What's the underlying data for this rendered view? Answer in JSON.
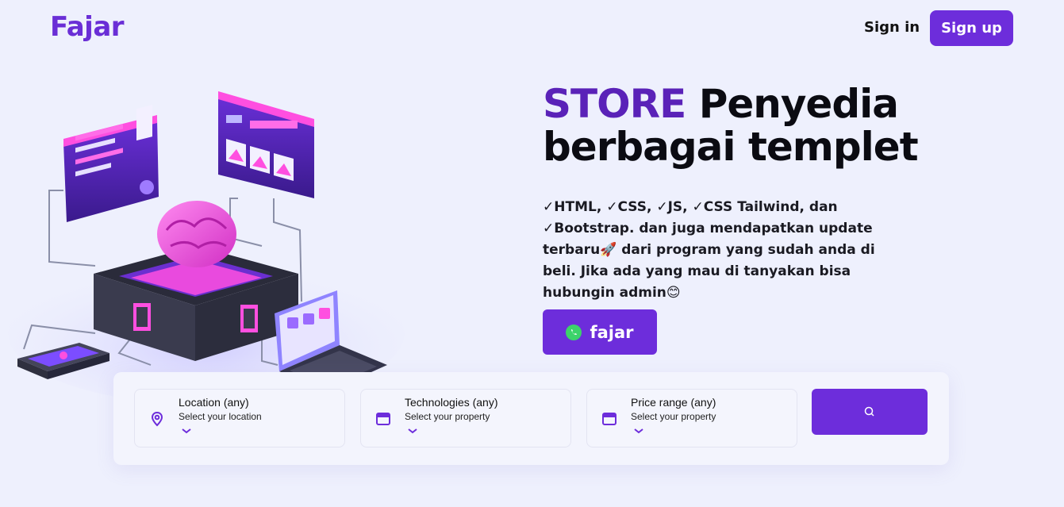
{
  "header": {
    "logo": "Fajar",
    "sign_in_label": "Sign in",
    "sign_up_label": "Sign up"
  },
  "hero": {
    "headline_accent": "STORE",
    "headline_rest": " Penyedia berbagai templet",
    "description": "✓HTML, ✓CSS, ✓JS, ✓CSS Tailwind, dan ✓Bootstrap. dan juga mendapatkan update terbaru🚀 dari program yang sudah anda di beli. Jika ada yang mau di tanyakan bisa hubungin admin😊",
    "cta_label": "fajar",
    "cta_icon": "whatsapp-icon"
  },
  "search": {
    "fields": [
      {
        "title": "Location (any)",
        "subtitle": "Select your location",
        "icon": "location-pin-icon"
      },
      {
        "title": "Technologies (any)",
        "subtitle": "Select your property",
        "icon": "browser-window-icon"
      },
      {
        "title": "Price range (any)",
        "subtitle": "Select your property",
        "icon": "browser-window-icon"
      }
    ],
    "button_icon": "search-icon"
  },
  "colors": {
    "brand": "#6d2ddb",
    "accent_text": "#5a22b8",
    "background": "#eef0fd",
    "whatsapp": "#3cd36a"
  }
}
